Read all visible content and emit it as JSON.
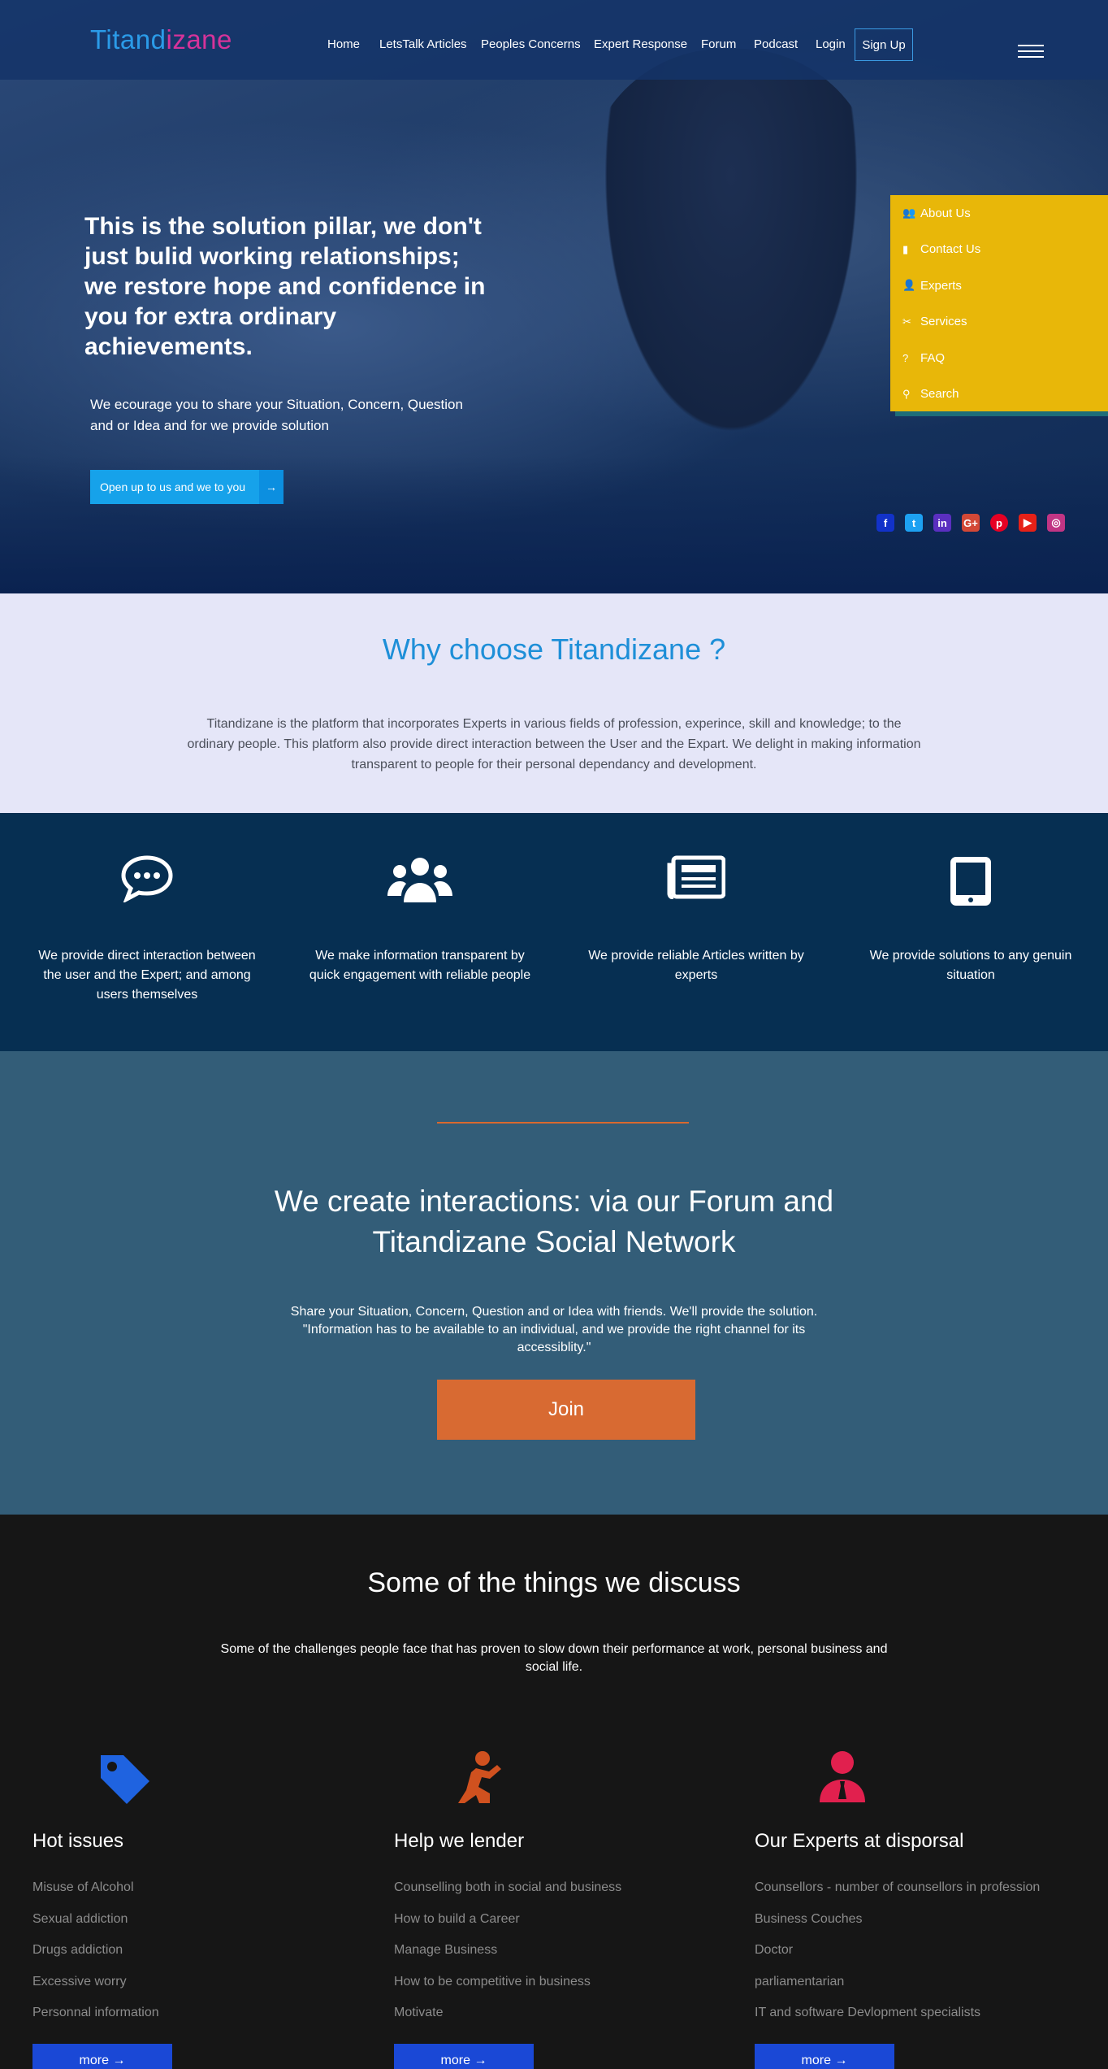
{
  "header": {
    "logo_part1": "Titand",
    "logo_part2": "izane",
    "nav": [
      "Home",
      "LetsTalk Articles",
      "Peoples Concerns",
      "Expert Response",
      "Forum",
      "Podcast",
      "Login"
    ],
    "signup": "Sign Up"
  },
  "hero": {
    "heading": "This is the solution pillar, we don't just bulid working relationships; we restore hope and confidence in you for extra ordinary achievements.",
    "subtext": "We ecourage you to share your Situation, Concern, Question and or Idea and for we provide solution",
    "cta_label": "Open up to us and we to you",
    "cta_arrow": "→"
  },
  "side_menu": [
    {
      "icon": "users-icon",
      "glyph": "👥",
      "label": "About Us"
    },
    {
      "icon": "mobile-icon",
      "glyph": "▮",
      "label": "Contact Us"
    },
    {
      "icon": "user-icon",
      "glyph": "👤",
      "label": "Experts"
    },
    {
      "icon": "tools-icon",
      "glyph": "✂",
      "label": "Services"
    },
    {
      "icon": "question-icon",
      "glyph": "?",
      "label": "FAQ"
    },
    {
      "icon": "search-icon",
      "glyph": "⚲",
      "label": "Search"
    }
  ],
  "social": [
    {
      "name": "facebook-icon",
      "glyph": "f",
      "color": "#1232c9"
    },
    {
      "name": "twitter-icon",
      "glyph": "t",
      "color": "#1da1f2"
    },
    {
      "name": "linkedin-icon",
      "glyph": "in",
      "color": "#5a2fc0"
    },
    {
      "name": "google-plus-icon",
      "glyph": "G+",
      "color": "#d34836"
    },
    {
      "name": "pinterest-icon",
      "glyph": "p",
      "color": "#e60023"
    },
    {
      "name": "youtube-icon",
      "glyph": "▶",
      "color": "#e62117"
    },
    {
      "name": "instagram-icon",
      "glyph": "◎",
      "color": "#c13584"
    }
  ],
  "why": {
    "title": "Why choose Titandizane ?",
    "text": "Titandizane is the platform that incorporates Experts in various fields of profession, experince, skill and knowledge; to the ordinary people. This platform also provide direct interaction between the User and the Expart. We delight in making information transparent to people for their personal dependancy and development."
  },
  "features": [
    {
      "icon": "comment-icon",
      "text": "We provide direct interaction between the user and the Expert; and among users themselves"
    },
    {
      "icon": "users-icon",
      "text": "We make information transparent by quick engagement with reliable people"
    },
    {
      "icon": "newspaper-icon",
      "text": "We provide reliable Articles written by experts"
    },
    {
      "icon": "tablet-icon",
      "text": "We provide solutions to any genuin situation"
    }
  ],
  "interact": {
    "title": "We create interactions: via our Forum and Titandizane Social Network",
    "text": "Share your Situation, Concern, Question and or Idea with friends. We'll provide the solution. \"Information has to be available to an individual, and we provide the right channel for its accessiblity.\"",
    "join": "Join"
  },
  "discuss": {
    "title": "Some of the things we discuss",
    "lead": "Some of the challenges people face that has proven to slow down their performance at work, personal business and social life.",
    "columns": [
      {
        "icon": "tag-icon",
        "color": "#1f63e0",
        "title": "Hot issues",
        "items": [
          "Misuse of Alcohol",
          "Sexual addiction",
          "Drugs addiction",
          "Excessive worry",
          "Personnal information"
        ],
        "more": "more →"
      },
      {
        "icon": "praying-icon",
        "color": "#d0511f",
        "title": "Help we lender",
        "items": [
          "Counselling both in social and business",
          "How to build a Career",
          "Manage Business",
          "How to be competitive in business",
          "Motivate"
        ],
        "more": "more →"
      },
      {
        "icon": "user-tie-icon",
        "color": "#e1204e",
        "title": "Our Experts at disporsal",
        "items": [
          "Counsellors - number of counsellors in profession",
          "Business Couches",
          "Doctor",
          "parliamentarian",
          "IT and software Devlopment specialists"
        ],
        "more": "more →"
      }
    ]
  }
}
